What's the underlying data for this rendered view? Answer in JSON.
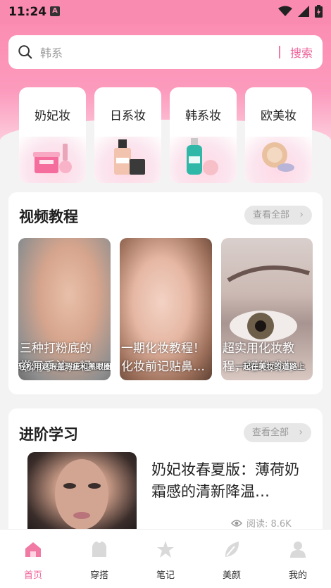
{
  "status_bar": {
    "time": "11:24",
    "notif_icon_letter": "A"
  },
  "search": {
    "placeholder": "韩系",
    "button_label": "搜索"
  },
  "categories": [
    {
      "label": "奶妃妆",
      "icon": "cosmetics-jar-icon"
    },
    {
      "label": "日系妆",
      "icon": "foundation-bottle-icon"
    },
    {
      "label": "韩系妆",
      "icon": "lotion-bottle-icon"
    },
    {
      "label": "欧美妆",
      "icon": "powder-compact-icon"
    }
  ],
  "video_section": {
    "title": "视频教程",
    "more_label": "查看全部",
    "videos": [
      {
        "caption_line1": "三种打粉底的",
        "caption_line2": "常用手法，轻",
        "overlay": "轻松用遮瑕盖瑕疵和黑眼圈"
      },
      {
        "caption_line1": "一期化妆教程！",
        "caption_line2": "化妆前记贴鼻…",
        "overlay": "化妆前记贴鼻"
      },
      {
        "caption_line1": "超实用化妆教",
        "caption_line2": "程，轻松成为",
        "overlay": "一起在美妆的道路上"
      }
    ]
  },
  "advanced_section": {
    "title": "进阶学习",
    "more_label": "查看全部",
    "lesson": {
      "title": "奶妃妆春夏版：薄荷奶霜感的清新降温…",
      "reads": "阅读: 8.6K"
    }
  },
  "tabs": [
    {
      "label": "首页",
      "icon": "home-icon",
      "active": true
    },
    {
      "label": "穿搭",
      "icon": "tshirt-icon",
      "active": false
    },
    {
      "label": "笔记",
      "icon": "star-note-icon",
      "active": false
    },
    {
      "label": "美颜",
      "icon": "leaf-icon",
      "active": false
    },
    {
      "label": "我的",
      "icon": "user-icon",
      "active": false
    }
  ],
  "colors": {
    "brand_pink": "#f98bb0",
    "accent_pink": "#f0649a"
  }
}
